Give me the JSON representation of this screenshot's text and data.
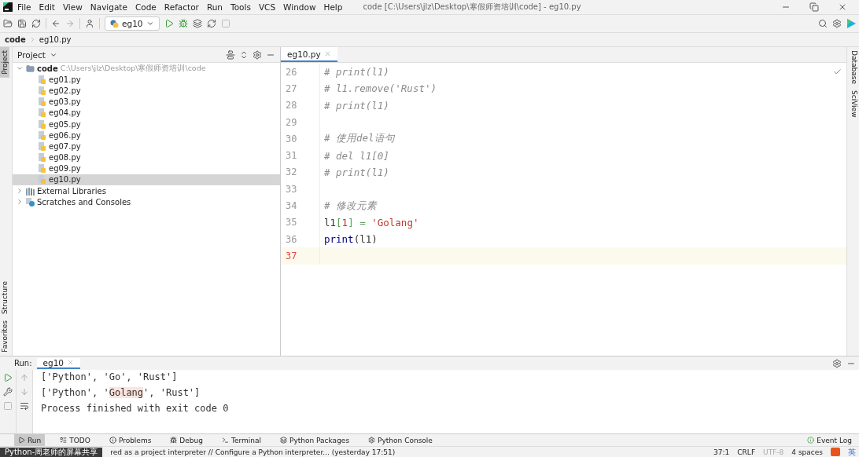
{
  "menu": [
    "File",
    "Edit",
    "View",
    "Navigate",
    "Code",
    "Refactor",
    "Run",
    "Tools",
    "VCS",
    "Window",
    "Help"
  ],
  "window": {
    "title": "code [C:\\Users\\jlz\\Desktop\\寒假师资培训\\code] - eg10.py"
  },
  "toolbar": {
    "run_config": "eg10"
  },
  "breadcrumb": [
    "code",
    "eg10.py"
  ],
  "left_strip": {
    "top": [
      {
        "label": "Project",
        "selected": true
      }
    ],
    "bottom": [
      {
        "label": "Structure",
        "selected": false
      },
      {
        "label": "Favorites",
        "selected": false
      }
    ]
  },
  "right_strip": [
    {
      "label": "Database"
    },
    {
      "label": "SciView"
    }
  ],
  "project_panel": {
    "title": "Project",
    "tree": [
      {
        "label": "code",
        "path": "C:\\Users\\jlz\\Desktop\\寒假师资培训\\code",
        "kind": "folder",
        "expanded": true,
        "selected": false,
        "children": [
          {
            "label": "eg01.py",
            "kind": "file",
            "selected": false
          },
          {
            "label": "eg02.py",
            "kind": "file",
            "selected": false
          },
          {
            "label": "eg03.py",
            "kind": "file",
            "selected": false
          },
          {
            "label": "eg04.py",
            "kind": "file",
            "selected": false
          },
          {
            "label": "eg05.py",
            "kind": "file",
            "selected": false
          },
          {
            "label": "eg06.py",
            "kind": "file",
            "selected": false
          },
          {
            "label": "eg07.py",
            "kind": "file",
            "selected": false
          },
          {
            "label": "eg08.py",
            "kind": "file",
            "selected": false
          },
          {
            "label": "eg09.py",
            "kind": "file",
            "selected": false
          },
          {
            "label": "eg10.py",
            "kind": "file",
            "selected": true
          }
        ]
      },
      {
        "label": "External Libraries",
        "kind": "libraries",
        "expanded": false,
        "selected": false
      },
      {
        "label": "Scratches and Consoles",
        "kind": "scratches",
        "expanded": false,
        "selected": false
      }
    ]
  },
  "editor": {
    "tabs": [
      {
        "label": "eg10.py",
        "selected": true
      }
    ],
    "lines": [
      {
        "number": "26",
        "current": false,
        "segments": [
          {
            "kind": "comment",
            "text": "# print(l1)"
          }
        ]
      },
      {
        "number": "27",
        "current": false,
        "segments": [
          {
            "kind": "comment",
            "text": "# l1.remove('Rust')"
          }
        ]
      },
      {
        "number": "28",
        "current": false,
        "segments": [
          {
            "kind": "comment",
            "text": "# print(l1)"
          }
        ]
      },
      {
        "number": "29",
        "current": false
      },
      {
        "number": "30",
        "current": false,
        "segments": [
          {
            "kind": "comment",
            "text": "# 使用del语句"
          }
        ]
      },
      {
        "number": "31",
        "current": false,
        "segments": [
          {
            "kind": "comment",
            "text": "# del l1[0]"
          }
        ]
      },
      {
        "number": "32",
        "current": false,
        "segments": [
          {
            "kind": "comment",
            "text": "# print(l1)"
          }
        ]
      },
      {
        "number": "33",
        "current": false
      },
      {
        "number": "34",
        "current": false,
        "segments": [
          {
            "kind": "comment",
            "text": "# 修改元素"
          }
        ]
      },
      {
        "number": "35",
        "current": false,
        "segments": [
          {
            "kind": "plain",
            "text": "l1"
          },
          {
            "kind": "bracket",
            "text": "["
          },
          {
            "kind": "number",
            "text": "1"
          },
          {
            "kind": "bracket",
            "text": "]"
          },
          {
            "kind": "operator",
            "text": " = "
          },
          {
            "kind": "string",
            "text": "'Golang'"
          }
        ]
      },
      {
        "number": "36",
        "current": false,
        "segments": [
          {
            "kind": "builtin",
            "text": "print"
          },
          {
            "kind": "plain",
            "text": "(l1)"
          }
        ]
      },
      {
        "number": "37",
        "current": true
      }
    ]
  },
  "run_panel": {
    "label": "Run:",
    "tabs": [
      {
        "label": "eg10",
        "selected": true
      }
    ],
    "output": [
      {
        "parts": [
          {
            "text": "['Python', 'Go', 'Rust']",
            "highlight": false
          }
        ]
      },
      {
        "parts": [
          {
            "text": "['Python', '",
            "highlight": false
          },
          {
            "text": "Golang",
            "highlight": true
          },
          {
            "text": "', 'Rust']",
            "highlight": false
          }
        ]
      },
      {
        "parts": [
          {
            "text": "Process finished with exit code 0",
            "highlight": false
          }
        ]
      }
    ]
  },
  "tool_windows": [
    {
      "label": "Run",
      "selected": true
    },
    {
      "label": "TODO",
      "selected": false
    },
    {
      "label": "Problems",
      "selected": false
    },
    {
      "label": "Debug",
      "selected": false
    },
    {
      "label": "Terminal",
      "selected": false
    },
    {
      "label": "Python Packages",
      "selected": false
    },
    {
      "label": "Python Console",
      "selected": false
    }
  ],
  "event_log": "Event Log",
  "share_badge": "Python-周老师的屏幕共享",
  "status": {
    "message": "red as a project interpreter // Configure a Python interpreter... (yesterday 17:51)",
    "position": "37:1",
    "line_sep": "CRLF",
    "encoding": "UTF-8",
    "indent": "4 spaces",
    "ime": "英"
  }
}
